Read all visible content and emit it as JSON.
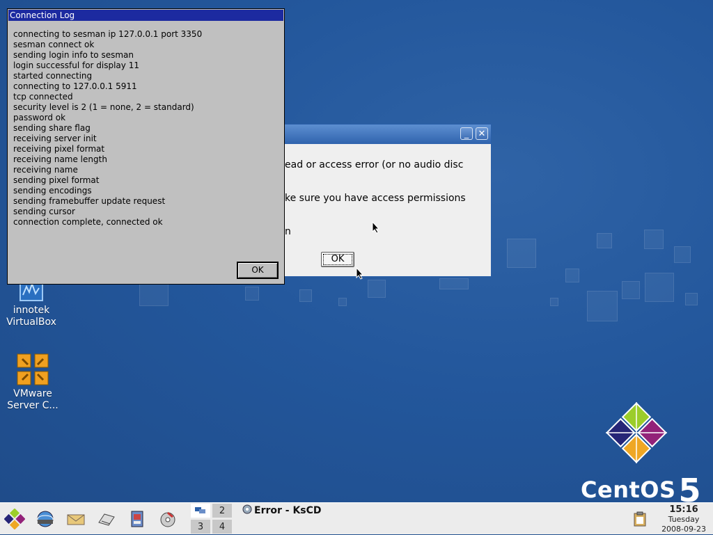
{
  "desktop": {
    "icons": [
      {
        "label_line1": "innotek",
        "label_line2": "VirtualBox",
        "icon": "virtualbox-icon"
      },
      {
        "label_line1": "VMware",
        "label_line2": "Server C...",
        "icon": "vmware-icon"
      }
    ],
    "brand": {
      "name": "CentOS",
      "version": "5"
    }
  },
  "kscd_dialog": {
    "lines": [
      "ead or access error (or no audio disc",
      "ke sure you have access permissions",
      "n"
    ],
    "ok_label": "OK",
    "minimize_label": "_",
    "close_label": "✕"
  },
  "connection_log": {
    "title": "Connection Log",
    "lines": [
      "connecting to sesman ip 127.0.0.1 port 3350",
      "sesman connect ok",
      "sending login info to sesman",
      "login successful for display 11",
      "started connecting",
      "connecting to 127.0.0.1 5911",
      "tcp connected",
      "security level is 2 (1 = none, 2 = standard)",
      "password ok",
      "sending share flag",
      "receiving server init",
      "receiving pixel format",
      "receiving name length",
      "receiving name",
      "sending pixel format",
      "sending encodings",
      "sending framebuffer update request",
      "sending cursor",
      "connection complete, connected ok"
    ],
    "ok_label": "OK"
  },
  "taskbar": {
    "launchers": [
      "start-menu-icon",
      "browser-icon",
      "mail-icon",
      "file-manager-icon",
      "office-icon",
      "media-icon"
    ],
    "pager": [
      "1",
      "2",
      "3",
      "4"
    ],
    "task_title": "Error - KsCD",
    "clock": {
      "time": "15:16",
      "day": "Tuesday",
      "date": "2008-09-23"
    }
  }
}
